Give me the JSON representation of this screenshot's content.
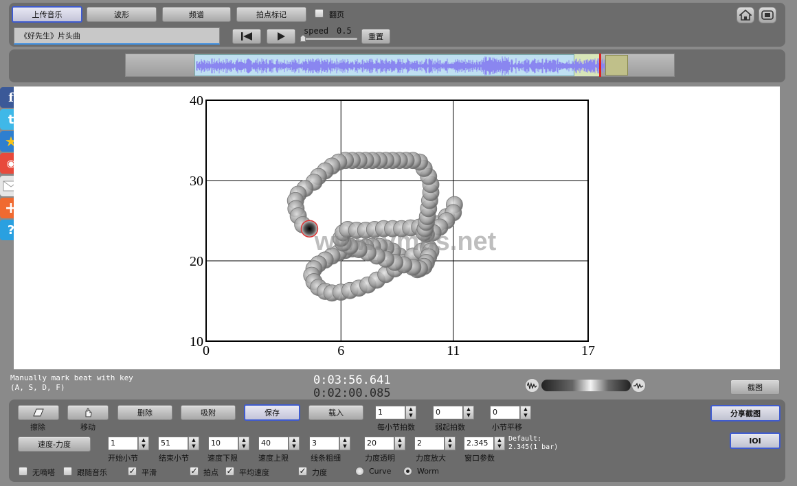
{
  "toolbar": {
    "upload_label": "上传音乐",
    "waveform_label": "波形",
    "spectrum_label": "频谱",
    "beatmark_label": "拍点标记",
    "pageflip_label": "翻页",
    "song_title": "《好先生》片头曲",
    "speed_label": "speed",
    "speed_value": "0.5",
    "reset_label": "重置"
  },
  "chart_data": {
    "type": "scatter",
    "x_ticks": [
      "0",
      "6",
      "11",
      "17"
    ],
    "y_ticks": [
      "40",
      "30",
      "20",
      "10"
    ],
    "xlim": [
      0,
      17
    ],
    "ylim": [
      10,
      40
    ],
    "grid": true,
    "watermark": "www.vmus.net",
    "series": [
      {
        "x": [
          4.6,
          4.3,
          4.1,
          4.0,
          3.98,
          4.1,
          4.4,
          4.8,
          5.0,
          5.3,
          5.6,
          5.9,
          6.2,
          6.5,
          6.8,
          7.1,
          7.4,
          7.7,
          8.0,
          8.3,
          8.6,
          8.9,
          9.2,
          9.5,
          9.7,
          9.9,
          10.0,
          10.0,
          9.95,
          9.9,
          9.85,
          9.8,
          9.75,
          9.7,
          9.8,
          10.1,
          10.4,
          10.7,
          11.0,
          11.05,
          10.7,
          10.3,
          9.9,
          9.5,
          9.1,
          8.7,
          8.3,
          7.9,
          7.5,
          7.1,
          6.7,
          6.3,
          6.1,
          6.0,
          6.1,
          6.4,
          6.8,
          7.2,
          7.6,
          8.0,
          8.4,
          8.8,
          9.2,
          9.5,
          9.7,
          9.8,
          9.9,
          10.0,
          9.9,
          9.6,
          9.2,
          8.8,
          8.4,
          8.0,
          7.6,
          7.2,
          6.8,
          6.4,
          6.0,
          5.6,
          5.3,
          5.0,
          4.8,
          4.7,
          4.8,
          5.0,
          5.3,
          5.6,
          5.9,
          6.2,
          6.5,
          6.8,
          7.1,
          7.4,
          7.7,
          8.0,
          8.3,
          8.6,
          8.9,
          9.2,
          9.4
        ],
        "y": [
          24.0,
          24.5,
          25.6,
          26.5,
          27.5,
          28.3,
          29.0,
          29.8,
          30.5,
          31.2,
          31.8,
          32.3,
          32.5,
          32.5,
          32.5,
          32.5,
          32.5,
          32.5,
          32.5,
          32.5,
          32.5,
          32.5,
          32.5,
          32.3,
          31.5,
          30.5,
          29.5,
          28.5,
          27.5,
          26.5,
          25.5,
          24.8,
          24.0,
          23.5,
          23.3,
          23.5,
          24.2,
          25.0,
          26.0,
          27.0,
          25.5,
          24.6,
          24.3,
          24.2,
          24.1,
          24.0,
          24.0,
          24.0,
          23.9,
          23.8,
          23.8,
          23.9,
          23.5,
          22.8,
          22.2,
          21.8,
          21.4,
          21.0,
          20.6,
          20.2,
          19.8,
          19.5,
          19.2,
          19.0,
          19.3,
          19.8,
          20.5,
          21.2,
          21.6,
          21.2,
          20.6,
          19.8,
          19.0,
          18.3,
          17.6,
          17.0,
          16.6,
          16.3,
          16.1,
          16.0,
          16.2,
          16.7,
          17.4,
          18.2,
          19.0,
          19.6,
          20.1,
          20.6,
          21.0,
          21.3,
          21.5,
          21.6,
          21.7,
          21.8,
          21.8,
          21.6,
          21.2,
          20.6,
          20.0,
          19.4,
          18.9
        ]
      }
    ]
  },
  "status": {
    "hint_line1": "Manually mark beat with key",
    "hint_line2": "(A, S, D, F)",
    "time_total": "0:03:56.641",
    "time_current": "0:02:00.085",
    "screenshot_label": "截图"
  },
  "controls": {
    "erase_label": "擦除",
    "move_label": "移动",
    "delete_label": "删除",
    "snap_label": "吸附",
    "save_label": "保存",
    "load_label": "载入",
    "beats_per_bar_value": "1",
    "beats_per_bar_label": "每小节拍数",
    "pickup_value": "0",
    "pickup_label": "弱起拍数",
    "bar_shift_value": "0",
    "bar_shift_label": "小节平移",
    "share_label": "分享截图",
    "ioi_label": "IOI",
    "speed_dyn_label": "速度-力度",
    "start_bar_value": "1",
    "start_bar_label": "开始小节",
    "end_bar_value": "51",
    "end_bar_label": "结束小节",
    "speed_min_value": "10",
    "speed_min_label": "速度下限",
    "speed_max_value": "40",
    "speed_max_label": "速度上限",
    "line_width_value": "3",
    "line_width_label": "线条粗细",
    "dyn_alpha_value": "20",
    "dyn_alpha_label": "力度透明",
    "dyn_scale_value": "2",
    "dyn_scale_label": "力度放大",
    "window_value": "2.345",
    "window_label": "窗口参数",
    "default_line1": "Default:",
    "default_line2": "2.345(1 bar)",
    "no_tick_label": "无嘀嗒",
    "follow_music_label": "跟随音乐",
    "smooth_label": "平滑",
    "beat_point_label": "拍点",
    "avg_speed_label": "平均速度",
    "dynamics_label": "力度",
    "curve_label": "Curve",
    "worm_label": "Worm"
  },
  "colors": {
    "waveform": "#8a86f0",
    "accent_blue": "#3f5bd0",
    "playhead": "#dd2222"
  }
}
